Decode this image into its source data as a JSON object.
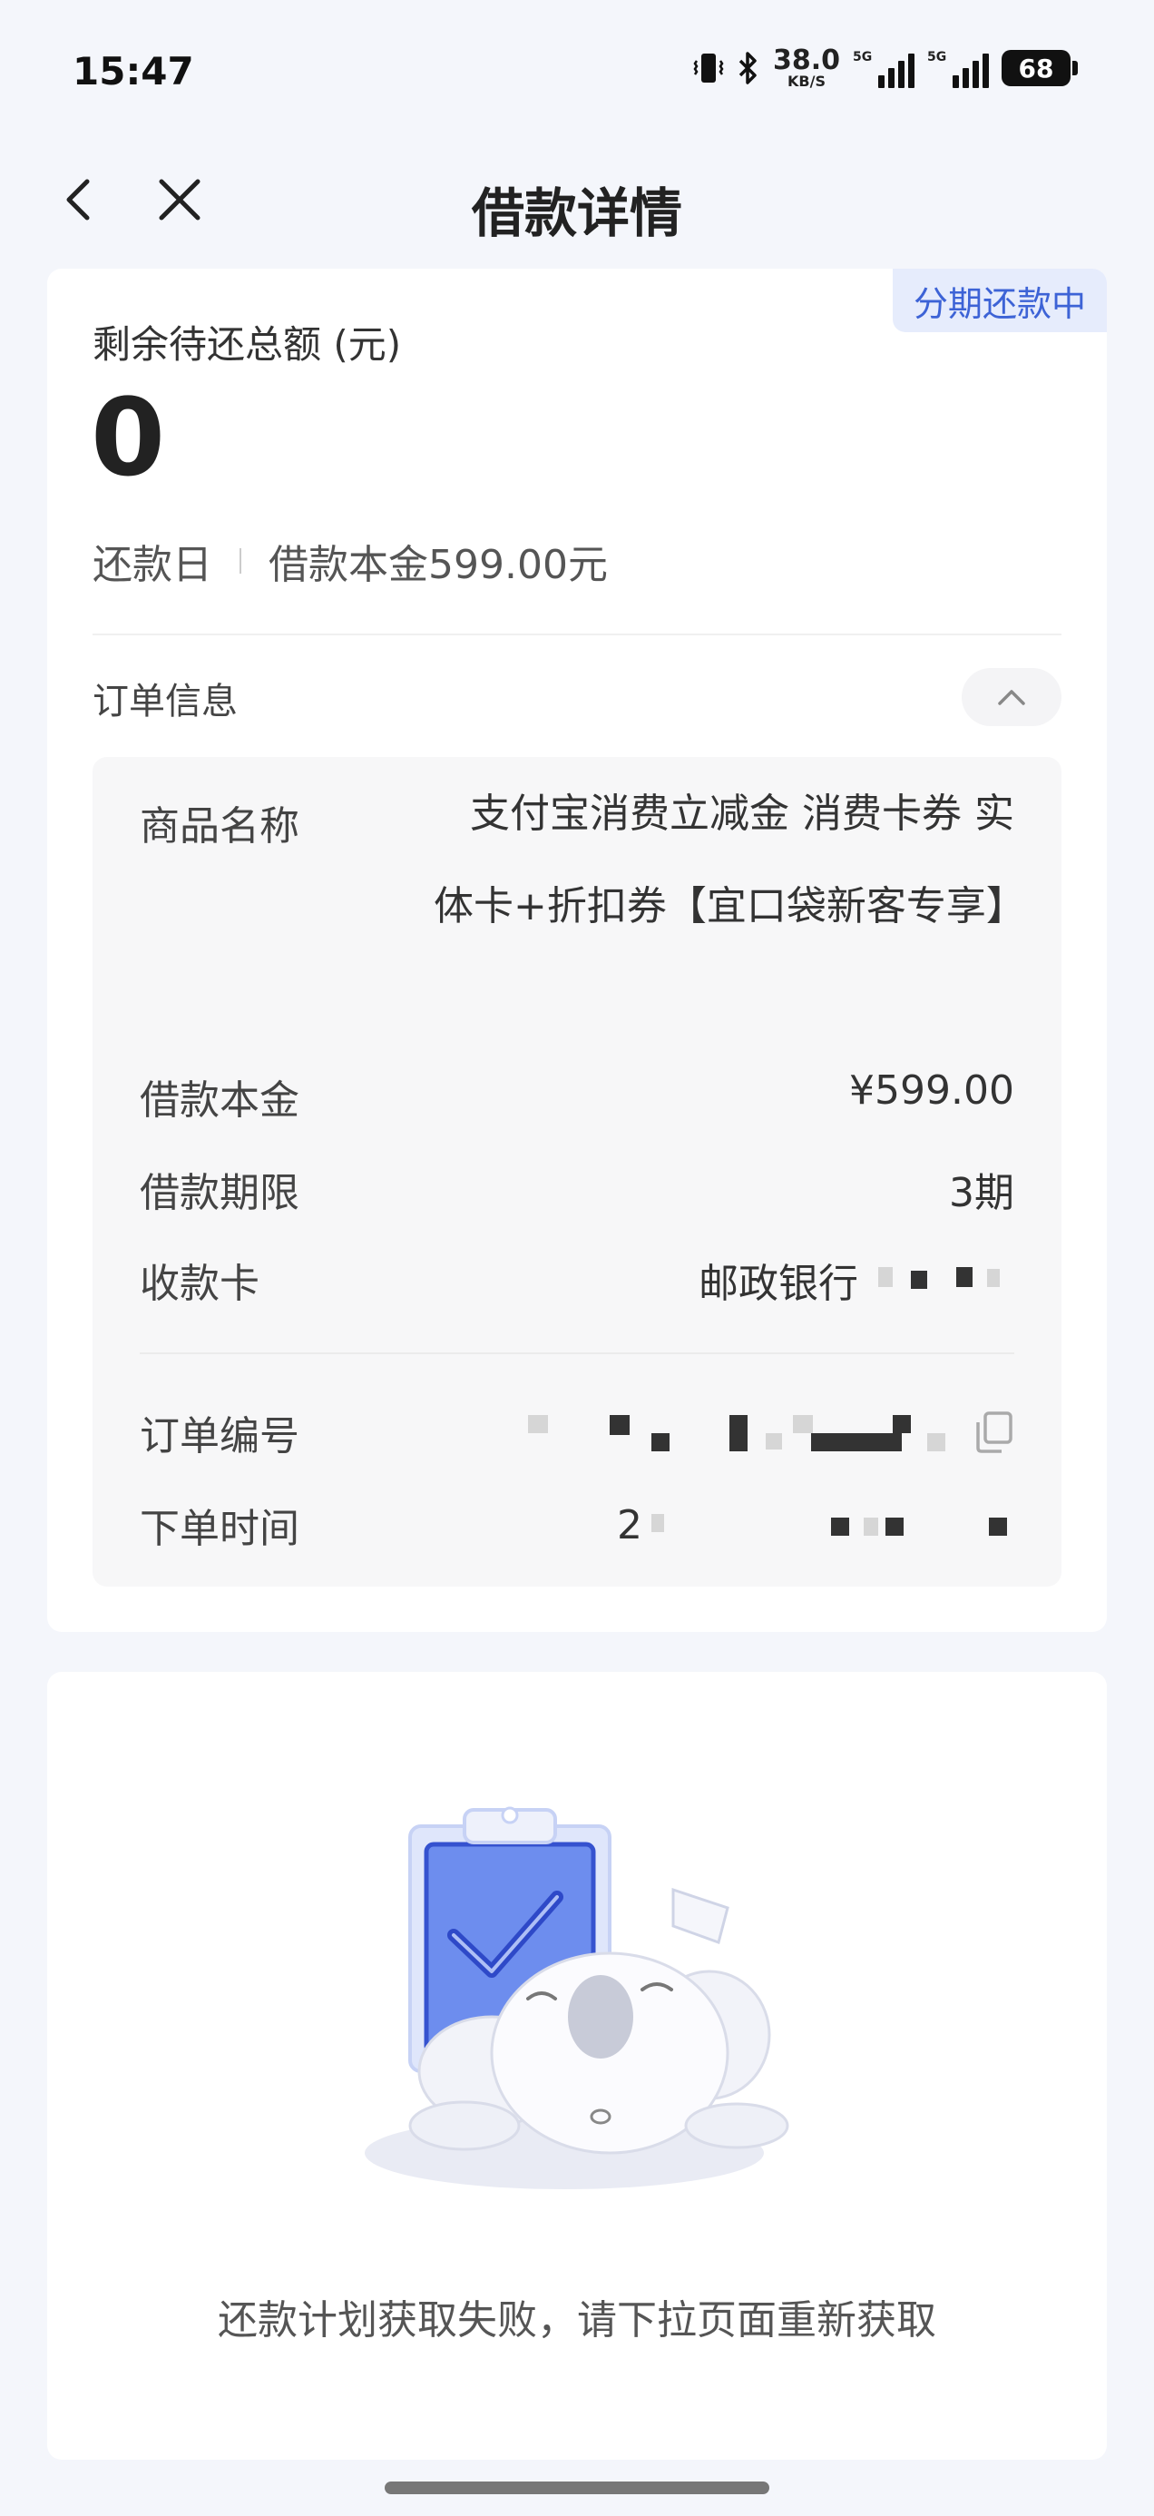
{
  "status_bar": {
    "time": "15:47",
    "net_speed": "38.0",
    "net_unit": "KB/S",
    "signal1_label": "5G",
    "signal2_label": "5G",
    "battery": "68"
  },
  "nav": {
    "title": "借款详情",
    "back_icon": "chevron-left-icon",
    "close_icon": "close-icon"
  },
  "summary": {
    "tag": "分期还款中",
    "remaining_label": "剩余待还总额 (元)",
    "remaining_amount": "0",
    "repay_day_label": "还款日",
    "principal_text": "借款本金599.00元"
  },
  "order": {
    "title": "订单信息",
    "product_label": "商品名称",
    "product_value": "支付宝消费立减金 消费卡券 实体卡+折扣券【宜口袋新客专享】",
    "principal_label": "借款本金",
    "principal_value": "¥599.00",
    "term_label": "借款期限",
    "term_value": "3期",
    "card_label": "收款卡",
    "card_value": "邮政银行",
    "order_no_label": "订单编号",
    "order_time_label": "下单时间",
    "order_time_value": "2"
  },
  "plan": {
    "fail_message": "还款计划获取失败，请下拉页面重新获取"
  },
  "colors": {
    "accent": "#3d63d6",
    "tag_bg": "#e6ecfc",
    "page_bg": "#f4f6fb"
  }
}
